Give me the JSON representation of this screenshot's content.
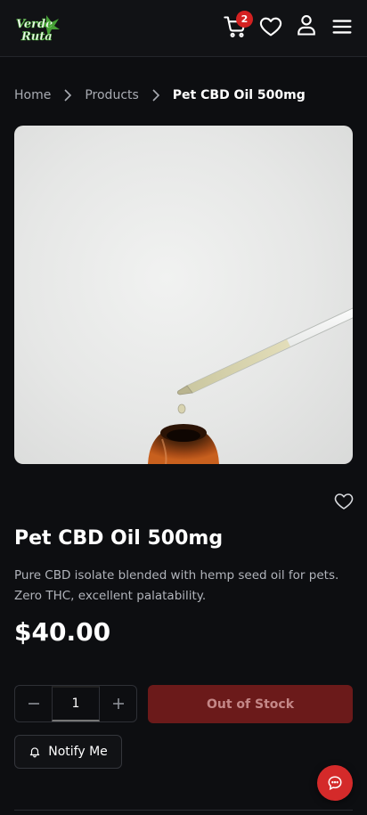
{
  "header": {
    "brand": "Verde Ruta",
    "cart_count": "2",
    "icons": [
      "cart-icon",
      "heart-icon",
      "user-icon",
      "menu-icon"
    ]
  },
  "breadcrumb": {
    "items": [
      "Home",
      "Products",
      "Pet CBD Oil 500mg"
    ]
  },
  "product": {
    "title": "Pet CBD Oil 500mg",
    "description": "Pure CBD isolate blended with hemp seed oil for pets. Zero THC, excellent palatability.",
    "price": "$40.00",
    "quantity": "1",
    "stock_button": "Out of Stock",
    "notify_button": "Notify Me"
  },
  "colors": {
    "background": "#0d0e11",
    "accent": "#d42121",
    "out_of_stock": "#6b1a1a",
    "brand_green": "#4caf3a"
  }
}
